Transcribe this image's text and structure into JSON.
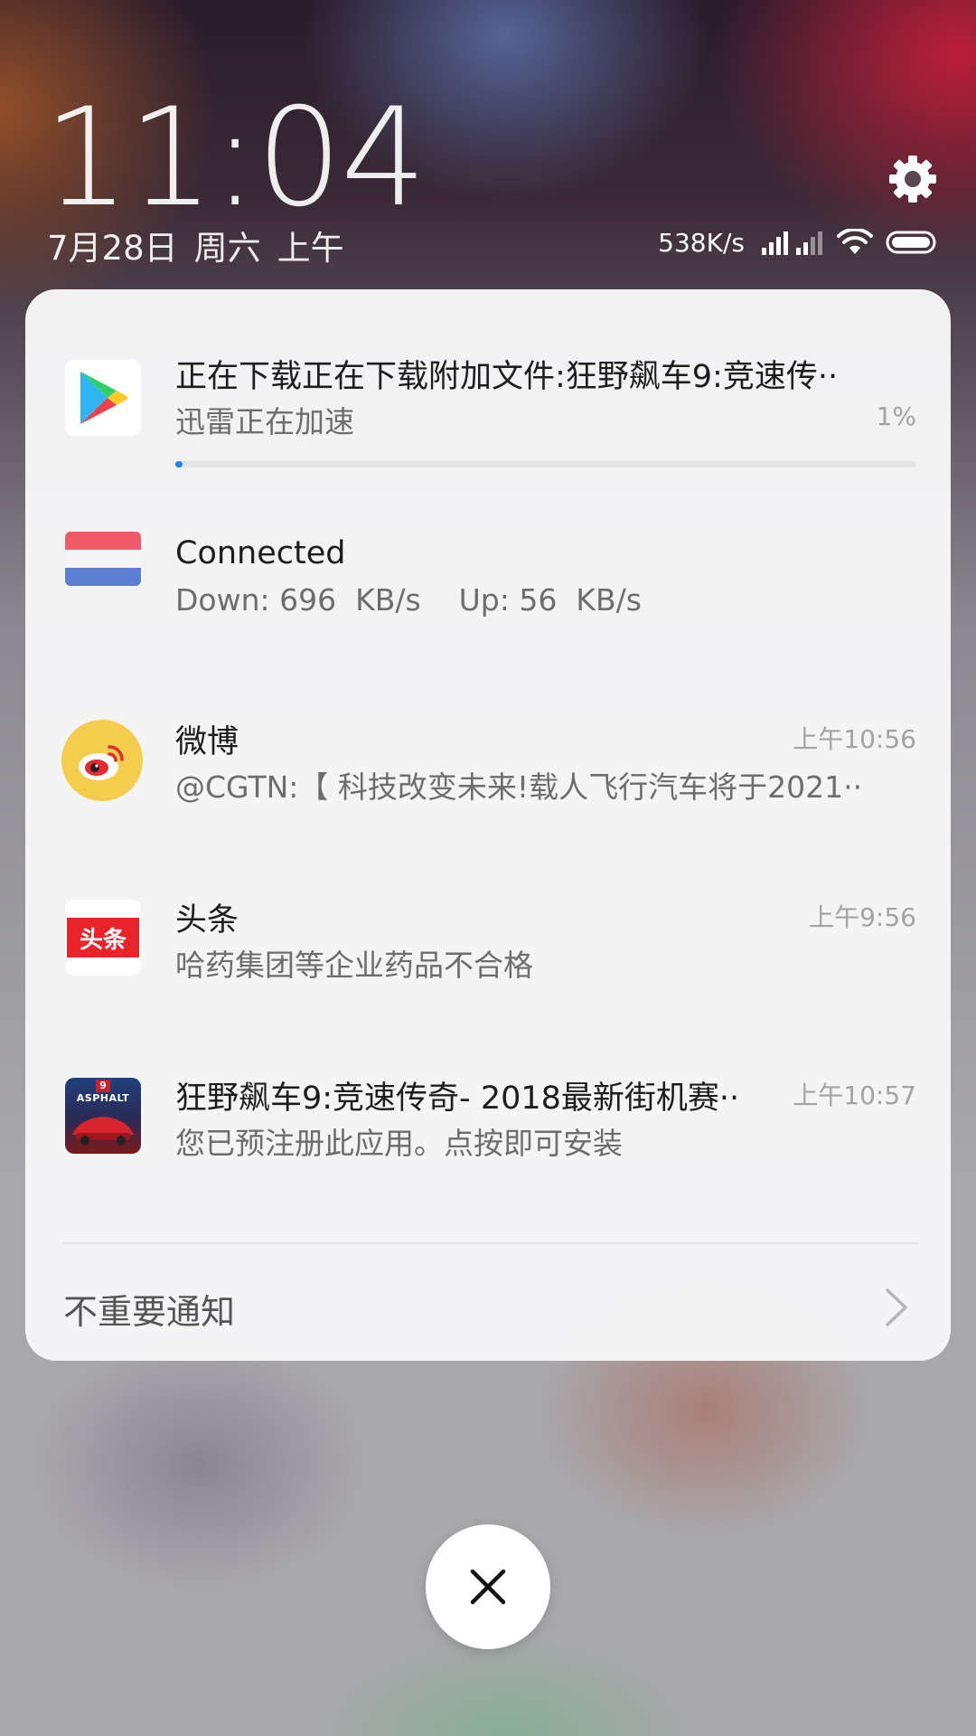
{
  "lockscreen": {
    "time": "11:04",
    "date_parts": [
      "7月28日",
      "周六",
      "上午"
    ]
  },
  "statusbar": {
    "net_speed": "538K/s",
    "icons": [
      "signal-icon",
      "signal-weak-icon",
      "wifi-icon",
      "battery-icon"
    ]
  },
  "notifications": [
    {
      "app_icon": "google-play-icon",
      "title": "正在下载正在下载附加文件:狂野飙车9:竞速传··",
      "text": "迅雷正在加速",
      "progress_label": "1%",
      "progress_value": 0.01
    },
    {
      "app_icon": "flag-netherlands-icon",
      "title": "Connected",
      "text": "Down: 696  KB/s    Up: 56  KB/s"
    },
    {
      "app_icon": "weibo-icon",
      "title": "微博",
      "text": "@CGTN:【 科技改变未来!载人飞行汽车将于2021··",
      "time": "上午10:56"
    },
    {
      "app_icon": "toutiao-icon",
      "icon_text": "头条",
      "title": "头条",
      "text": "哈药集团等企业药品不合格",
      "time": "上午9:56"
    },
    {
      "app_icon": "asphalt-icon",
      "icon_text": "ASPHALT",
      "icon_badge": "9",
      "title": "狂野飙车9:竞速传奇- 2018最新街机赛··",
      "text": "您已预注册此应用。点按即可安装",
      "time": "上午10:57"
    }
  ],
  "footer": {
    "unimportant_label": "不重要通知"
  },
  "colors": {
    "progress": "#1a84f0",
    "toutiao_red": "#e8242a",
    "weibo_yellow": "#f3cd4b"
  }
}
